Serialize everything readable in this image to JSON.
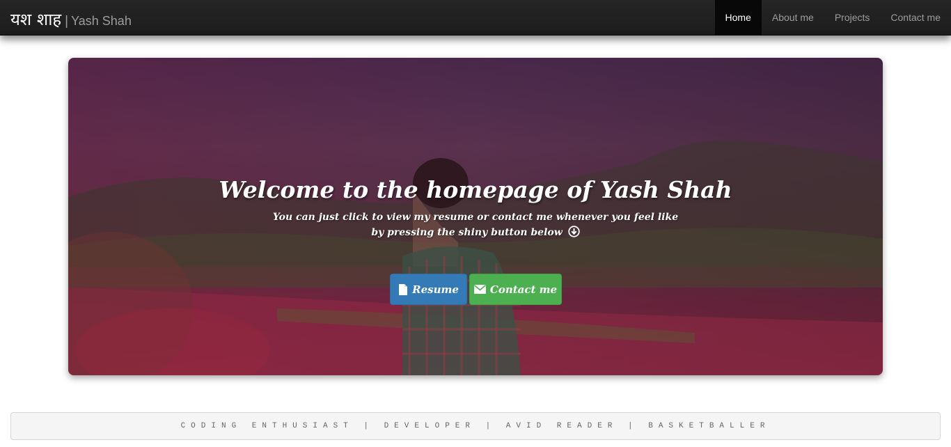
{
  "navbar": {
    "brand_native": "यश शाह",
    "brand_separator": "|",
    "brand_name": "Yash Shah",
    "items": [
      {
        "label": "Home",
        "active": true
      },
      {
        "label": "About me",
        "active": false
      },
      {
        "label": "Projects",
        "active": false
      },
      {
        "label": "Contact me",
        "active": false
      }
    ]
  },
  "hero": {
    "title": "Welcome to the homepage of Yash Shah",
    "subtitle_line1": "You can just click to view my resume or contact me whenever you feel like",
    "subtitle_line2": "by pressing the shiny button below",
    "subtitle_icon": "arrow-down-circle-icon",
    "buttons": {
      "resume_label": "Resume",
      "resume_icon": "document-icon",
      "resume_color": "#337ab7",
      "contact_label": "Contact me",
      "contact_icon": "envelope-icon",
      "contact_color": "#4caf50"
    }
  },
  "tagline": "CODING ENTHUSIAST | DEVELOPER | AVID READER | BASKETBALLER"
}
